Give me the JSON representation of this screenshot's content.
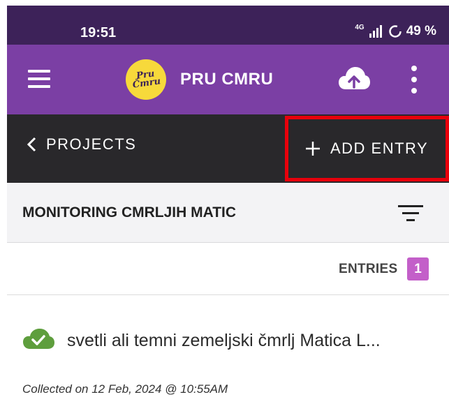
{
  "status_bar": {
    "time": "19:51",
    "network": "4G",
    "battery": "49 %"
  },
  "app_bar": {
    "logo_text_line1": "Pru",
    "logo_text_line2": "Čmru",
    "title": "PRU CMRU",
    "icons": [
      "menu-icon",
      "cloud-upload-icon",
      "more-vert-icon"
    ]
  },
  "nav": {
    "back_label": "PROJECTS",
    "add_entry_label": "ADD ENTRY"
  },
  "project": {
    "title": "MONITORING CMRLJIH MATIC"
  },
  "entries": {
    "label": "ENTRIES",
    "count": "1"
  },
  "entry": {
    "title": "svetli ali temni zemeljski čmrlj Matica L...",
    "collected": "Collected on 12 Feb, 2024 @ 10:55AM"
  },
  "colors": {
    "status_bar": "#3d2259",
    "app_bar": "#7b3fa4",
    "nav_bar": "#29282b",
    "highlight": "#e8000b",
    "badge": "#c35fc9",
    "synced": "#5e9e3d"
  }
}
